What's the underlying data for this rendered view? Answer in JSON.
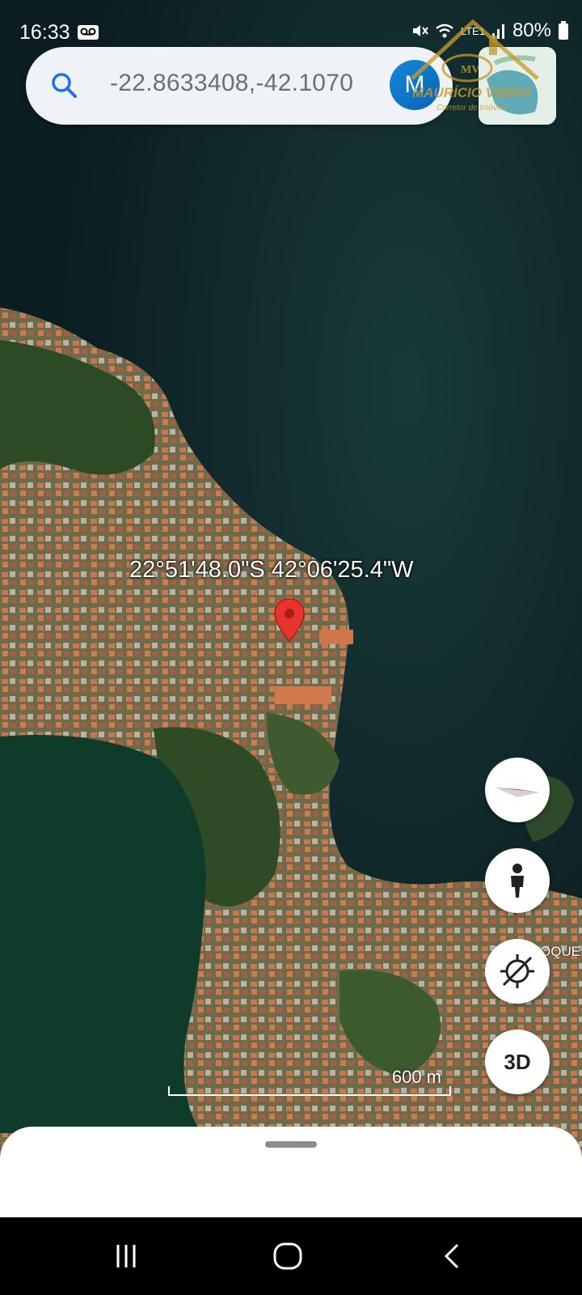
{
  "status_bar": {
    "time": "16:33",
    "battery": "80%",
    "network": "LTE1",
    "icons": [
      "voicemail-icon",
      "mute-icon",
      "wifi-icon",
      "signal-icon",
      "battery-icon"
    ]
  },
  "search": {
    "query": "-22.8633408,-42.1070",
    "avatar_letter": "M",
    "icon": "search-icon"
  },
  "watermark": {
    "brand": "MAURÍCIO VIEIRA",
    "tagline": "Corretor de Imóveis"
  },
  "map": {
    "coordinates_label": "22°51'48.0\"S 42°06'25.4\"W",
    "place_label": "OQUEI",
    "scale_label": "600 m",
    "colors": {
      "water": "#0f2a2e",
      "lagoon": "#0e3a28",
      "land": "#5a5e3e",
      "urban": "#b8774f",
      "pin": "#e8342c"
    }
  },
  "controls": {
    "compass": "compass-icon",
    "street_view": "pegman-icon",
    "location": "location-off-icon",
    "three_d_label": "3D"
  },
  "nav": [
    "recents-icon",
    "home-icon",
    "back-icon"
  ]
}
